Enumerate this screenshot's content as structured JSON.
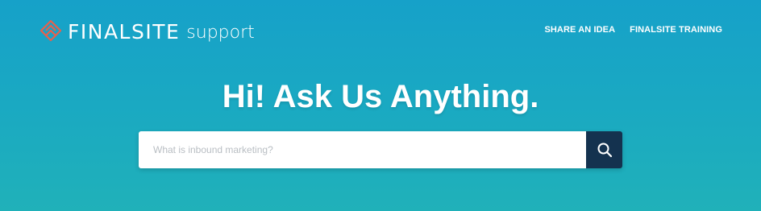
{
  "header": {
    "logo_wordmark": "FINALSITE",
    "logo_suffix": "support",
    "nav": [
      {
        "label": "SHARE AN IDEA"
      },
      {
        "label": "FINALSITE TRAINING"
      }
    ]
  },
  "hero": {
    "headline": "Hi! Ask Us Anything."
  },
  "search": {
    "placeholder": "What is inbound marketing?",
    "value": "",
    "button_icon": "search-icon"
  },
  "colors": {
    "background_top": "#16a1c9",
    "background_bottom": "#20b1b9",
    "logo_mark": "#e8604c",
    "search_button": "#14324f",
    "text": "#ffffff"
  }
}
